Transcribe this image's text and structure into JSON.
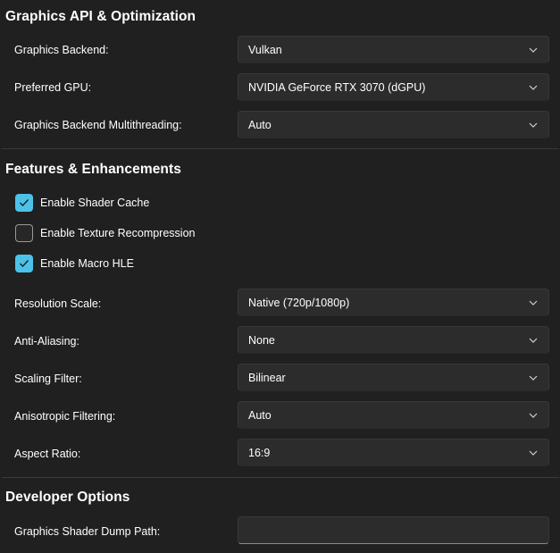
{
  "sections": {
    "graphics_api": {
      "title": "Graphics API & Optimization",
      "rows": [
        {
          "label": "Graphics Backend:",
          "value": "Vulkan"
        },
        {
          "label": "Preferred GPU:",
          "value": "NVIDIA GeForce RTX 3070 (dGPU)"
        },
        {
          "label": "Graphics Backend Multithreading:",
          "value": "Auto"
        }
      ]
    },
    "features": {
      "title": "Features & Enhancements",
      "checkboxes": [
        {
          "label": "Enable Shader Cache",
          "checked": true
        },
        {
          "label": "Enable Texture Recompression",
          "checked": false
        },
        {
          "label": "Enable Macro HLE",
          "checked": true
        }
      ],
      "rows": [
        {
          "label": "Resolution Scale:",
          "value": "Native (720p/1080p)"
        },
        {
          "label": "Anti-Aliasing:",
          "value": "None"
        },
        {
          "label": "Scaling Filter:",
          "value": "Bilinear"
        },
        {
          "label": "Anisotropic Filtering:",
          "value": "Auto"
        },
        {
          "label": "Aspect Ratio:",
          "value": "16:9"
        }
      ]
    },
    "developer": {
      "title": "Developer Options",
      "rows": [
        {
          "label": "Graphics Shader Dump Path:",
          "value": ""
        }
      ]
    }
  },
  "colors": {
    "background": "#202020",
    "control_bg": "#2c2c2c",
    "accent": "#4cc2e8",
    "divider": "#3a3a3a"
  },
  "icons": {
    "dropdown": "chevron-down-icon",
    "check": "checkmark-icon"
  }
}
